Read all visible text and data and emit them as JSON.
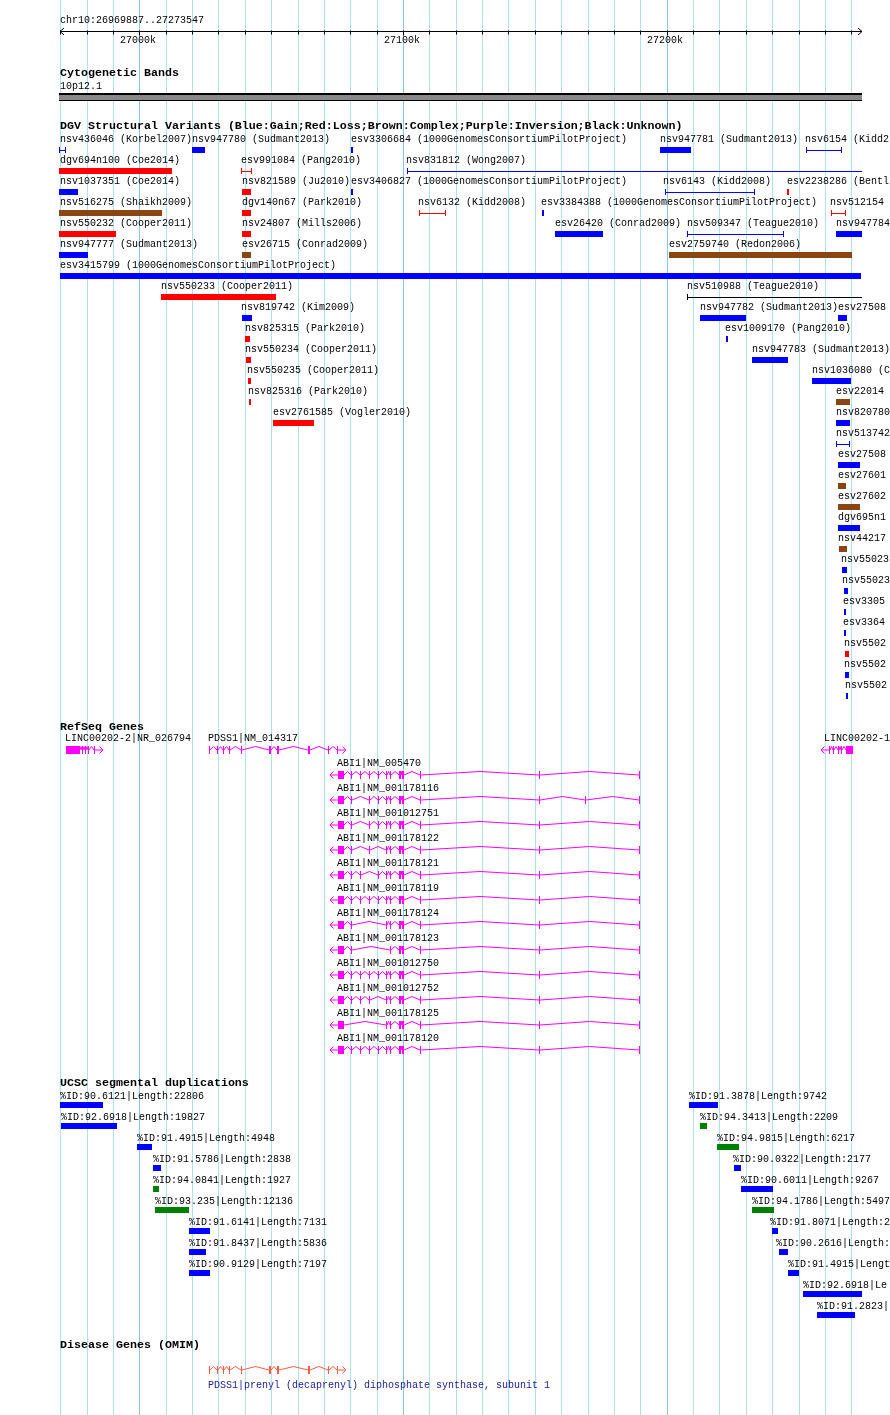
{
  "ruler": {
    "range": "chr10:26969887..27273547",
    "tick_labels": [
      "27000k",
      "27100k",
      "27200k"
    ]
  },
  "cytogenetic_bands": {
    "title": "Cytogenetic Bands",
    "band": "10p12.1"
  },
  "dgv_variants": {
    "title": "DGV Structural Variants (Blue:Gain;Red:Loss;Brown:Complex;Purple:Inversion;Black:Unknown)",
    "features": [
      {
        "label": "nsv436046 (Korbel2007)",
        "kind": "span",
        "color": "#0000ff"
      },
      {
        "label": "nsv947780 (Sudmant2013)",
        "kind": "box",
        "color": "#0000ff"
      },
      {
        "label": "esv3306684 (1000GenomesConsortiumPilotProject)",
        "kind": "box",
        "color": "#0000ff"
      },
      {
        "label": "nsv947781 (Sudmant2013)",
        "kind": "box",
        "color": "#0000ff"
      },
      {
        "label": "nsv6154 (Kidd2",
        "kind": "span",
        "color": "#0000ff"
      },
      {
        "label": "dgv694n100 (Coe2014)",
        "kind": "box",
        "color": "#ff0000"
      },
      {
        "label": "esv991084 (Pang2010)",
        "kind": "span",
        "color": "#ff0000"
      },
      {
        "label": "nsv831812 (Wong2007)",
        "kind": "span",
        "color": "#0000ff"
      },
      {
        "label": "nsv1037351 (Coe2014)",
        "kind": "box",
        "color": "#0000ff"
      },
      {
        "label": "nsv821589 (Ju2010)",
        "kind": "box",
        "color": "#ff0000"
      },
      {
        "label": "esv3406827 (1000GenomesConsortiumPilotProject)",
        "kind": "box",
        "color": "#0000ff"
      },
      {
        "label": "nsv6143 (Kidd2008)",
        "kind": "span",
        "color": "#0000ff"
      },
      {
        "label": "esv2238286 (Bentl",
        "kind": "box",
        "color": "#ff0000"
      },
      {
        "label": "nsv516275 (Shaikh2009)",
        "kind": "box",
        "color": "#8b4513"
      },
      {
        "label": "dgv140n67 (Park2010)",
        "kind": "box",
        "color": "#ff0000"
      },
      {
        "label": "nsv6132 (Kidd2008)",
        "kind": "span",
        "color": "#ff0000"
      },
      {
        "label": "esv3384388 (1000GenomesConsortiumPilotProject)",
        "kind": "box",
        "color": "#0000ff"
      },
      {
        "label": "nsv512154",
        "kind": "span",
        "color": "#ff0000"
      },
      {
        "label": "nsv550232 (Cooper2011)",
        "kind": "box",
        "color": "#ff0000"
      },
      {
        "label": "nsv24807 (Mills2006)",
        "kind": "box",
        "color": "#ff0000"
      },
      {
        "label": "esv26420 (Conrad2009)",
        "kind": "box",
        "color": "#0000ff"
      },
      {
        "label": "nsv509347 (Teague2010)",
        "kind": "span",
        "color": "#0000ff"
      },
      {
        "label": "nsv947784",
        "kind": "box",
        "color": "#0000ff"
      },
      {
        "label": "nsv947777 (Sudmant2013)",
        "kind": "box",
        "color": "#0000ff"
      },
      {
        "label": "esv26715 (Conrad2009)",
        "kind": "box",
        "color": "#8b4513"
      },
      {
        "label": "esv2759740 (Redon2006)",
        "kind": "box",
        "color": "#8b4513"
      },
      {
        "label": "esv3415799 (1000GenomesConsortiumPilotProject)",
        "kind": "box",
        "color": "#0000ff"
      },
      {
        "label": "nsv550233 (Cooper2011)",
        "kind": "box",
        "color": "#ff0000"
      },
      {
        "label": "nsv510988 (Teague2010)",
        "kind": "span",
        "color": "#000000"
      },
      {
        "label": "nsv819742 (Kim2009)",
        "kind": "box",
        "color": "#0000ff"
      },
      {
        "label": "nsv947782 (Sudmant2013)",
        "kind": "box",
        "color": "#0000ff"
      },
      {
        "label": "esv27508",
        "kind": "box",
        "color": "#0000ff"
      },
      {
        "label": "nsv825315 (Park2010)",
        "kind": "box",
        "color": "#ff0000"
      },
      {
        "label": "esv1009170 (Pang2010)",
        "kind": "box",
        "color": "#0000ff"
      },
      {
        "label": "nsv550234 (Cooper2011)",
        "kind": "box",
        "color": "#ff0000"
      },
      {
        "label": "nsv947783 (Sudmant2013)",
        "kind": "box",
        "color": "#0000ff"
      },
      {
        "label": "nsv550235 (Cooper2011)",
        "kind": "box",
        "color": "#ff0000"
      },
      {
        "label": "nsv1036080 (C",
        "kind": "box",
        "color": "#0000ff"
      },
      {
        "label": "nsv825316 (Park2010)",
        "kind": "box",
        "color": "#ff0000"
      },
      {
        "label": "esv22014",
        "kind": "box",
        "color": "#8b4513"
      },
      {
        "label": "esv2761585 (Vogler2010)",
        "kind": "box",
        "color": "#ff0000"
      },
      {
        "label": "nsv820780",
        "kind": "box",
        "color": "#0000ff"
      },
      {
        "label": "nsv513742",
        "kind": "span",
        "color": "#0000ff"
      },
      {
        "label": "esv27508",
        "kind": "box",
        "color": "#0000ff"
      },
      {
        "label": "esv27601",
        "kind": "box",
        "color": "#8b4513"
      },
      {
        "label": "esv27602",
        "kind": "box",
        "color": "#8b4513"
      },
      {
        "label": "dgv695n1",
        "kind": "box",
        "color": "#0000ff"
      },
      {
        "label": "nsv44217",
        "kind": "box",
        "color": "#8b4513"
      },
      {
        "label": "nsv55023",
        "kind": "box",
        "color": "#0000ff"
      },
      {
        "label": "nsv55023",
        "kind": "box",
        "color": "#0000ff"
      },
      {
        "label": "esv3305",
        "kind": "box",
        "color": "#0000ff"
      },
      {
        "label": "esv3364",
        "kind": "box",
        "color": "#0000ff"
      },
      {
        "label": "nsv5502",
        "kind": "box",
        "color": "#ff0000"
      },
      {
        "label": "nsv5502",
        "kind": "box",
        "color": "#0000ff"
      },
      {
        "label": "nsv5502",
        "kind": "box",
        "color": "#0000ff"
      }
    ]
  },
  "refseq_genes": {
    "title": "RefSeq Genes",
    "genes": [
      {
        "label": "LINC00202-2|NR_026794",
        "reverse": false
      },
      {
        "label": "PDSS1|NM_014317",
        "reverse": false
      },
      {
        "label": "LINC00202-1",
        "reverse": true
      },
      {
        "label": "ABI1|NM_005470",
        "reverse": true
      },
      {
        "label": "ABI1|NM_001178116",
        "reverse": true
      },
      {
        "label": "ABI1|NM_001012751",
        "reverse": true
      },
      {
        "label": "ABI1|NM_001178122",
        "reverse": true
      },
      {
        "label": "ABI1|NM_001178121",
        "reverse": true
      },
      {
        "label": "ABI1|NM_001178119",
        "reverse": true
      },
      {
        "label": "ABI1|NM_001178124",
        "reverse": true
      },
      {
        "label": "ABI1|NM_001178123",
        "reverse": true
      },
      {
        "label": "ABI1|NM_001012750",
        "reverse": true
      },
      {
        "label": "ABI1|NM_001012752",
        "reverse": true
      },
      {
        "label": "ABI1|NM_001178125",
        "reverse": true
      },
      {
        "label": "ABI1|NM_001178120",
        "reverse": true
      }
    ]
  },
  "segmental_duplications": {
    "title": "UCSC segmental duplications",
    "features": [
      {
        "label": "%ID:90.6121|Length:22806",
        "color": "#0000ff"
      },
      {
        "label": "%ID:91.3878|Length:9742",
        "color": "#0000ff"
      },
      {
        "label": "%ID:92.6918|Length:19827",
        "color": "#0000ff"
      },
      {
        "label": "%ID:94.3413|Length:2209",
        "color": "#008000"
      },
      {
        "label": "%ID:91.4915|Length:4948",
        "color": "#0000ff"
      },
      {
        "label": "%ID:94.9815|Length:6217",
        "color": "#008000"
      },
      {
        "label": "%ID:91.5786|Length:2838",
        "color": "#0000ff"
      },
      {
        "label": "%ID:90.0322|Length:2177",
        "color": "#0000ff"
      },
      {
        "label": "%ID:94.0841|Length:1927",
        "color": "#008000"
      },
      {
        "label": "%ID:90.6011|Length:9267",
        "color": "#0000ff"
      },
      {
        "label": "%ID:93.235|Length:12136",
        "color": "#008000"
      },
      {
        "label": "%ID:94.1786|Length:5497",
        "color": "#008000"
      },
      {
        "label": "%ID:91.6141|Length:7131",
        "color": "#0000ff"
      },
      {
        "label": "%ID:91.8071|Length:2",
        "color": "#0000ff"
      },
      {
        "label": "%ID:91.8437|Length:5836",
        "color": "#0000ff"
      },
      {
        "label": "%ID:90.2616|Length:",
        "color": "#0000ff"
      },
      {
        "label": "%ID:90.9129|Length:7197",
        "color": "#0000ff"
      },
      {
        "label": "%ID:91.4915|Lengt",
        "color": "#0000ff"
      },
      {
        "label": "%ID:92.6918|Le",
        "color": "#0000ff"
      },
      {
        "label": "%ID:91.2823|",
        "color": "#0000ff"
      }
    ]
  },
  "disease_genes": {
    "title": "Disease Genes (OMIM)",
    "genes": [
      {
        "label": "PDSS1|prenyl (decaprenyl) diphosphate synthase, subunit 1",
        "reverse": false
      }
    ]
  }
}
